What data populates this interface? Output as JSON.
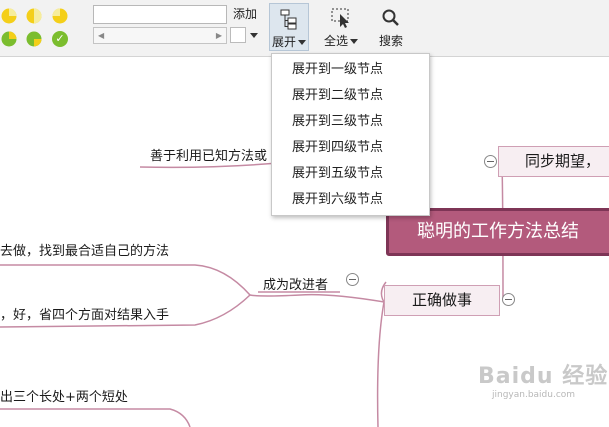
{
  "toolbar": {
    "add_button": "添加",
    "text_input_value": "",
    "expand_label": "展开",
    "select_all_label": "全选",
    "search_label": "搜索"
  },
  "expand_menu": {
    "items": [
      "展开到一级节点",
      "展开到二级节点",
      "展开到三级节点",
      "展开到四级节点",
      "展开到五级节点",
      "展开到六级节点"
    ]
  },
  "mindmap": {
    "central_topic": "聪明的工作方法总结",
    "topic_sync": "同步期望，",
    "topic_do_right": "正确做事",
    "subtopic_improver": "成为改进者",
    "leaf_known_method": "善于利用已知方法或",
    "leaf_best_method": "去做，找到最合适自己的方法",
    "leaf_four_aspects": "，好，省四个方面对结果入手",
    "leaf_strengths": "出三个长处+两个短处"
  },
  "watermark": {
    "brand": "Baidu 经验",
    "url": "jingyan.baidu.com"
  },
  "colors": {
    "branch_line": "#c58aa3",
    "central_fill": "#b35a7c",
    "topic_fill": "#f7eef2",
    "pie_yellow": "#f4cf19",
    "pie_green": "#7bbd2e"
  }
}
